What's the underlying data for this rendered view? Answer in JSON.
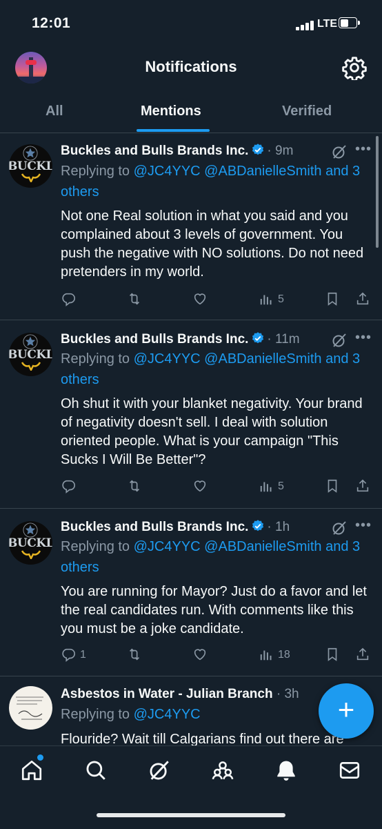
{
  "status_bar": {
    "time": "12:01",
    "network": "LTE"
  },
  "header": {
    "title": "Notifications",
    "settings_icon": "gear-icon"
  },
  "tabs": [
    {
      "label": "All",
      "active": false
    },
    {
      "label": "Mentions",
      "active": true
    },
    {
      "label": "Verified",
      "active": false
    }
  ],
  "tweets": [
    {
      "name": "Buckles and Bulls Brands Inc.",
      "time": "· 9m",
      "avatar_text": "BUCKLI",
      "replying_prefix": "Replying to ",
      "replying_handles": "@JC4YYC @ABDanielleSmith and 3 others",
      "text": "Not one Real solution in what you said and you complained about 3 levels of government. You push the negative with NO solutions. Do not need pretenders in my world.",
      "replies": "",
      "retweets": "",
      "likes": "",
      "views": "5"
    },
    {
      "name": "Buckles and Bulls Brands Inc.",
      "time": "· 11m",
      "avatar_text": "BUCKLI",
      "replying_prefix": "Replying to ",
      "replying_handles": "@JC4YYC @ABDanielleSmith and 3 others",
      "text": "Oh shut it with your blanket negativity. Your brand of negativity doesn't sell. I deal with solution oriented people. What is your campaign \"This Sucks I Will Be Better\"?",
      "replies": "",
      "retweets": "",
      "likes": "",
      "views": "5"
    },
    {
      "name": "Buckles and Bulls Brands Inc.",
      "time": "· 1h",
      "avatar_text": "BUCKLI",
      "replying_prefix": "Replying to ",
      "replying_handles": "@JC4YYC @ABDanielleSmith and 3 others",
      "text": "You are running for Mayor? Just do a favor and let the real candidates run. With comments like this you must be a joke candidate.",
      "replies": "1",
      "retweets": "",
      "likes": "",
      "views": "18"
    },
    {
      "name": "Asbestos in Water - Julian Branch",
      "time": "· 3h",
      "replying_prefix": "Replying to ",
      "replying_handles": "@JC4YYC",
      "text": "Flouride? Wait till Calgarians find out there are"
    }
  ],
  "fab": {
    "label": "+"
  },
  "bottom_nav": [
    "home-icon",
    "search-icon",
    "grok-icon",
    "communities-icon",
    "notifications-icon",
    "messages-icon"
  ],
  "colors": {
    "background": "#15202b",
    "accent": "#1d9bf0",
    "muted": "#8b98a5",
    "divider": "#38444d"
  }
}
